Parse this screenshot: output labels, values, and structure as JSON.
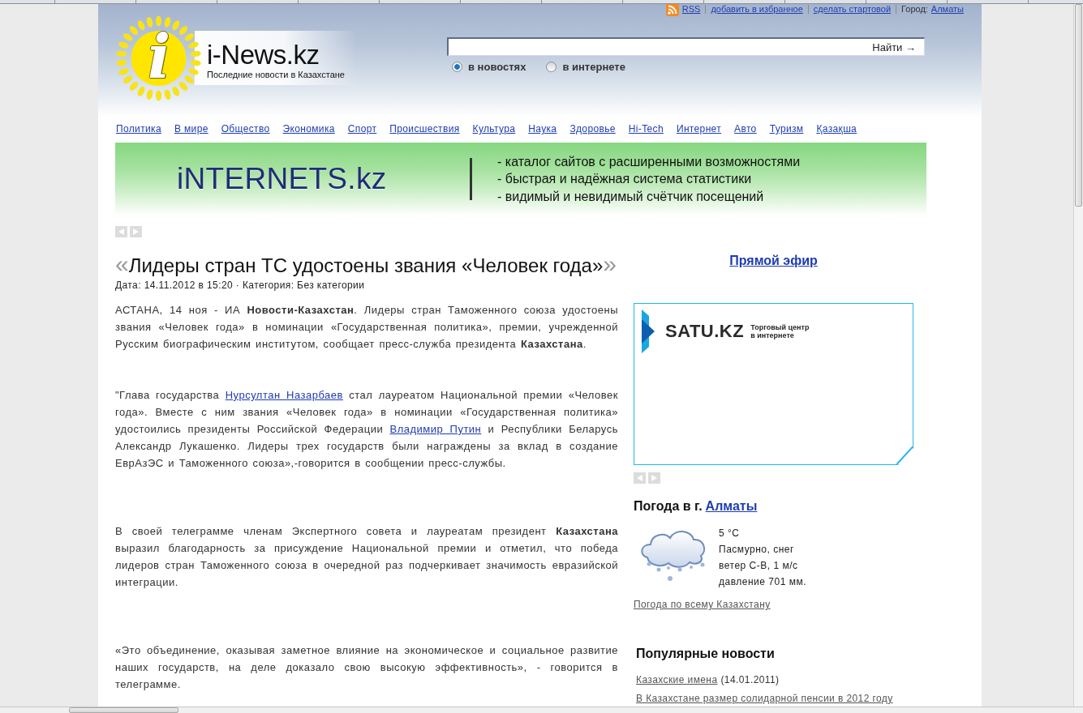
{
  "top_links": [
    {
      "kind": "rss",
      "label": "RSS"
    },
    {
      "kind": "link",
      "label": "добавить в избранное"
    },
    {
      "kind": "link",
      "label": "сделать стартовой"
    },
    {
      "kind": "city",
      "label": "Город:",
      "value": "Алматы"
    }
  ],
  "logo": {
    "badge": "i",
    "title": "i-News.kz",
    "tagline": "Последние новости в Казахстане"
  },
  "search": {
    "button": "Найти →",
    "scopes": [
      {
        "label": "в новостях",
        "selected": true
      },
      {
        "label": "в интернете",
        "selected": false
      }
    ]
  },
  "nav": [
    "Политика",
    "В мире",
    "Общество",
    "Экономика",
    "Спорт",
    "Происшествия",
    "Культура",
    "Наука",
    "Здоровье",
    "Hi-Tech",
    "Интернет",
    "Авто",
    "Туризм",
    "Қазақша"
  ],
  "banner": {
    "brand": "iNTERNETS.kz",
    "lines": [
      "- каталог сайтов с расширенными возможностями",
      "- быстрая и надёжная система статистики",
      "- видимый и невидимый счётчик посещений"
    ]
  },
  "article": {
    "title": {
      "open_mark": "«",
      "text": "Лидеры стран ТС удостоены звания «Человек года»",
      "close_mark": "»"
    },
    "meta": "Дата: 14.11.2012 в 15:20 · Категория: Без категории",
    "paragraphs": [
      {
        "segments": [
          {
            "kind": "text",
            "text": "АСТАНА, 14 ноя - ИА **Новости-Казахстан**. Лидеры стран Таможенного союза удостоены звания «Человек года» в номинации «Государственная политика», премии, учрежденной Русским биографическим институтом, сообщает пресс-служба президента **Казахстана**."
          }
        ]
      },
      {
        "segments": [
          {
            "kind": "text",
            "text": "\"Глава государства "
          },
          {
            "kind": "link",
            "text": "Нурсултан Назарбаев"
          },
          {
            "kind": "text",
            "text": " стал лауреатом Национальной премии «Человек года». Вместе с ним звания «Человек года» в номинации «Государственная политика» удостоились президенты Российской Федерации "
          },
          {
            "kind": "link",
            "text": "Владимир Путин"
          },
          {
            "kind": "text",
            "text": " и Республики Беларусь Александр Лукашенко. Лидеры трех государств были награждены за вклад в создание ЕврАзЭС и Таможенного союза»,-говорится в сообщении пресс-службы."
          }
        ]
      },
      {
        "segments": [
          {
            "kind": "text",
            "text": "В своей телеграмме членам Экспертного совета и лауреатам президент **Казахстана** выразил благодарность за присуждение Национальной премии и отметил, что победа лидеров стран Таможенного союза в очередной раз подчеркивает значимость евразийской интеграции."
          }
        ]
      },
      {
        "segments": [
          {
            "kind": "text",
            "text": "«Это объединение, оказывая заметное влияние на экономическое и социальное развитие наших государств, на деле доказало свою высокую эффективность», - говорится в телеграмме."
          }
        ]
      }
    ]
  },
  "sidebar": {
    "live_link": "Прямой эфир",
    "ad": {
      "brand": "SATU.KZ",
      "tagline": [
        "Торговый центр",
        "в интернете"
      ]
    },
    "weather": {
      "title": "Погода в г.",
      "city": "Алматы",
      "details": [
        "5 °С",
        "Пасмурно, снег",
        "ветер С-В, 1 м/с",
        "давление 701 мм."
      ],
      "all_link": "Погода по всему Казахстану"
    },
    "popular": {
      "title": "Популярные новости",
      "items": [
        {
          "title": "Казахские имена",
          "date": "(14.01.2011)"
        },
        {
          "title": "В Казахстане размер солидарной пенсии в 2012 году"
        }
      ]
    }
  }
}
